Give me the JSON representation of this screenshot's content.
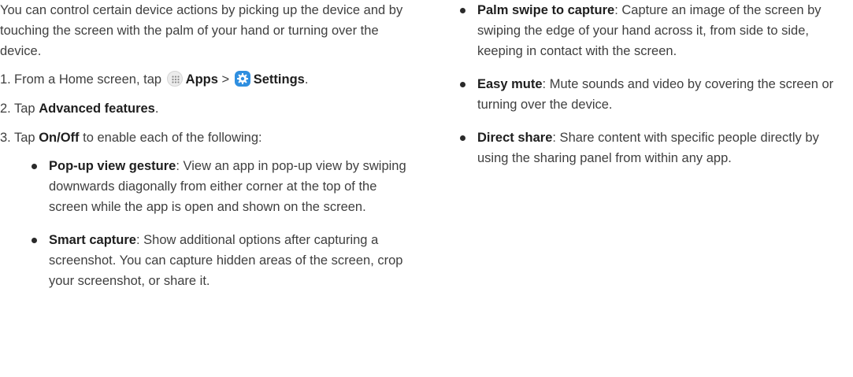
{
  "intro": "You can control certain device actions by picking up the device and by touching the screen with the palm of your hand or turning over the device.",
  "steps": [
    {
      "num": "1.",
      "prefix": "From a Home screen, tap",
      "apps_label": "Apps",
      "separator": ">",
      "settings_label": "Settings",
      "suffix": "."
    },
    {
      "num": "2.",
      "prefix": "Tap",
      "bold": "Advanced features",
      "suffix": "."
    },
    {
      "num": "3.",
      "prefix": "Tap",
      "bold": "On/Off",
      "suffix": "to enable each of the following:"
    }
  ],
  "features_left": [
    {
      "title": "Pop-up view gesture",
      "desc": ": View an app in pop-up view by swiping downwards diagonally from either corner at the top of the screen while the app is open and shown on the screen."
    },
    {
      "title": "Smart capture",
      "desc": ": Show additional options after capturing a screenshot. You can capture hidden areas of the screen, crop your screenshot, or share it."
    }
  ],
  "features_right": [
    {
      "title": "Palm swipe to capture",
      "desc": ": Capture an image of the screen by swiping the edge of your hand across it, from side to side, keeping in contact with the screen."
    },
    {
      "title": "Easy mute",
      "desc": ": Mute sounds and video by covering the screen or turning over the device."
    },
    {
      "title": "Direct share",
      "desc": ": Share content with specific people directly by using the sharing panel from within any app."
    }
  ],
  "icons": {
    "apps": "apps-grid-icon",
    "settings": "settings-gear-icon",
    "settings_color": "#2f8fe0"
  }
}
